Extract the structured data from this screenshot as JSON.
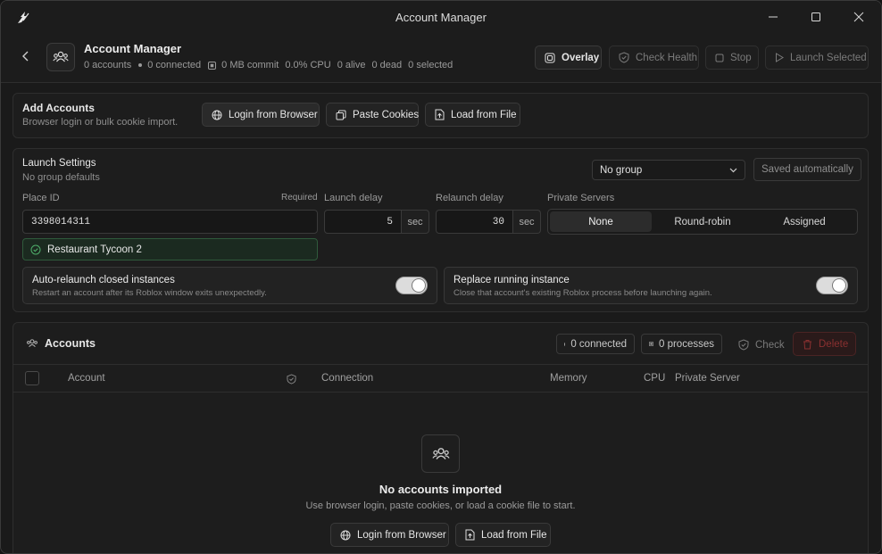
{
  "window": {
    "title": "Account Manager"
  },
  "header": {
    "title": "Account Manager",
    "stats": {
      "accounts": "0 accounts",
      "connected": "0 connected",
      "commit": "0 MB commit",
      "cpu": "0.0% CPU",
      "alive": "0 alive",
      "dead": "0 dead",
      "selected": "0 selected"
    },
    "buttons": {
      "overlay": "Overlay",
      "check_health": "Check Health",
      "stop": "Stop",
      "launch_selected": "Launch Selected"
    }
  },
  "add_accounts": {
    "title": "Add Accounts",
    "subtitle": "Browser login or bulk cookie import.",
    "login_browser": "Login from Browser",
    "paste_cookies": "Paste Cookies",
    "load_file": "Load from File"
  },
  "launch_settings": {
    "title": "Launch Settings",
    "subtitle": "No group defaults",
    "group_select": "No group",
    "saved_label": "Saved automatically",
    "place_id_label": "Place ID",
    "required_label": "Required",
    "place_id_value": "3398014311",
    "launch_delay_label": "Launch delay",
    "launch_delay_value": "5",
    "relaunch_delay_label": "Relaunch delay",
    "relaunch_delay_value": "30",
    "unit": "sec",
    "private_servers_label": "Private Servers",
    "private_servers_options": [
      "None",
      "Round-robin",
      "Assigned"
    ],
    "private_servers_selected": "None",
    "resolved_game": "Restaurant Tycoon 2",
    "auto_relaunch": {
      "title": "Auto-relaunch closed instances",
      "subtitle": "Restart an account after its Roblox window exits unexpectedly.",
      "enabled": true
    },
    "replace_running": {
      "title": "Replace running instance",
      "subtitle": "Close that account's existing Roblox process before launching again.",
      "enabled": true
    }
  },
  "accounts": {
    "title": "Accounts",
    "connected_pill": "0 connected",
    "processes_pill": "0 processes",
    "check": "Check",
    "delete": "Delete",
    "columns": [
      "Account",
      "Connection",
      "Memory",
      "CPU",
      "Private Server"
    ],
    "empty_title": "No accounts imported",
    "empty_sub": "Use browser login, paste cookies, or load a cookie file to start.",
    "empty_login": "Login from Browser",
    "empty_load": "Load from File"
  },
  "colors": {
    "accent_success": "#2f5a3b",
    "danger": "#8a3030",
    "background": "#1a1a1a"
  }
}
